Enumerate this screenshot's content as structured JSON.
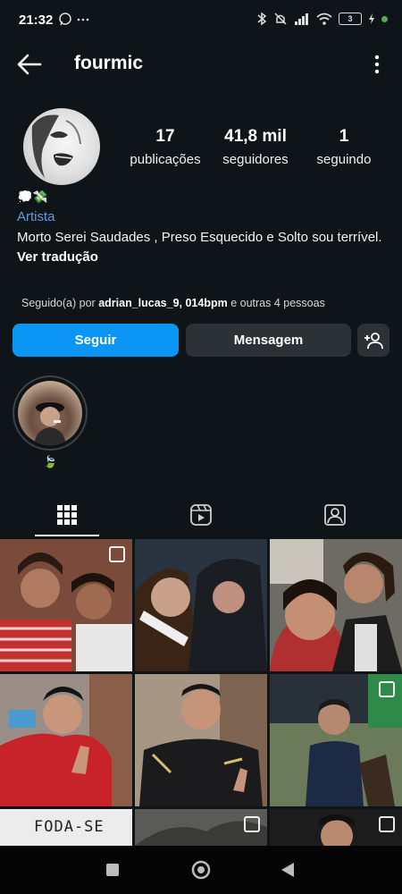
{
  "status": {
    "time": "21:32",
    "battery": "3"
  },
  "header": {
    "username": "fourmic"
  },
  "stats": [
    {
      "value": "17",
      "label": "publicações"
    },
    {
      "value": "41,8 mil",
      "label": "seguidores"
    },
    {
      "value": "1",
      "label": "seguindo"
    }
  ],
  "bio": {
    "emoji": "💭💸",
    "category": "Artista",
    "text": "Morto Serei Saudades , Preso Esquecido e  Solto sou terrível.",
    "translate": "Ver tradução"
  },
  "followed_by": {
    "prefix": "Seguido(a) por",
    "users": "adrian_lucas_9, 014bpm",
    "suffix": "e outras 4 pessoas"
  },
  "actions": {
    "follow": "Seguir",
    "message": "Mensagem"
  },
  "highlight": {
    "label": "🍃"
  },
  "colors": {
    "accent": "#0b95f4",
    "background": "#0f1418",
    "button": "#2c3136"
  },
  "tabs": [
    {
      "icon": "grid-icon"
    },
    {
      "icon": "reels-icon"
    },
    {
      "icon": "tagged-icon"
    }
  ],
  "posts": {
    "post7_text": "FODA-SE"
  }
}
